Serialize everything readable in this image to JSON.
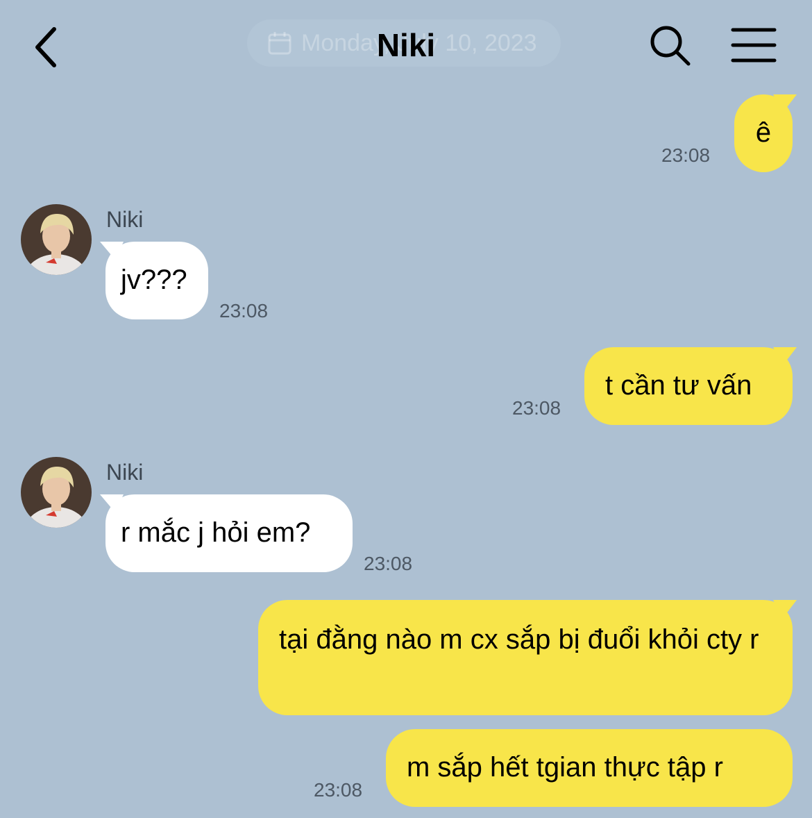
{
  "header": {
    "title": "Niki",
    "date_label": "Monday, July 10, 2023"
  },
  "messages": [
    {
      "from": "me",
      "text": "ê",
      "time": "23:08"
    },
    {
      "from": "them",
      "sender": "Niki",
      "text": "jv???",
      "time": "23:08"
    },
    {
      "from": "me",
      "text": "t cần tư vấn",
      "time": "23:08"
    },
    {
      "from": "them",
      "sender": "Niki",
      "text": "r mắc j hỏi em?",
      "time": "23:08"
    },
    {
      "from": "me",
      "text": "tại đằng nào m cx sắp bị đuổi khỏi cty r",
      "time": ""
    },
    {
      "from": "me",
      "text": "m sắp hết tgian thực tập r",
      "time": "23:08"
    }
  ],
  "colors": {
    "background": "#adc0d2",
    "my_bubble": "#f8e54a",
    "their_bubble": "#ffffff"
  },
  "icons": [
    "back-chevron-icon",
    "calendar-icon",
    "search-icon",
    "hamburger-menu-icon"
  ]
}
